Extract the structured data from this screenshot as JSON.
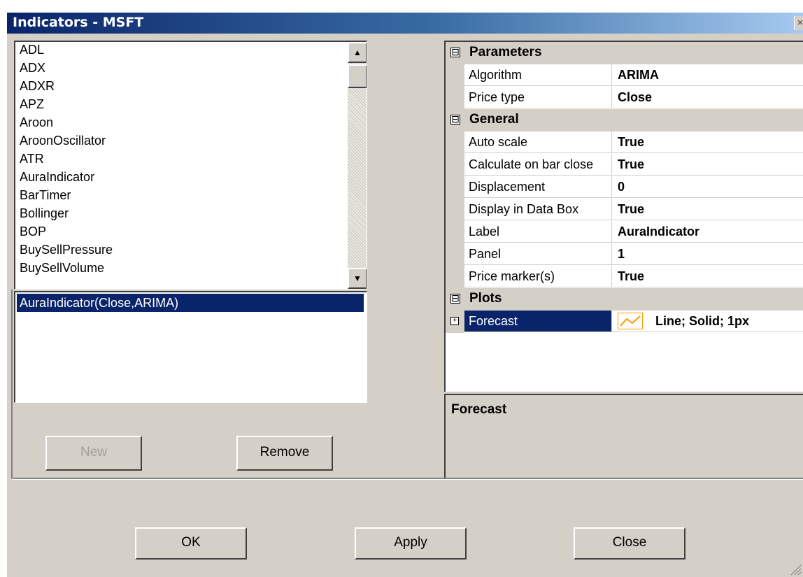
{
  "window": {
    "title": "Indicators - MSFT",
    "close_glyph": "×"
  },
  "indicator_list": {
    "items": [
      "ADL",
      "ADX",
      "ADXR",
      "APZ",
      "Aroon",
      "AroonOscillator",
      "ATR",
      "AuraIndicator",
      "BarTimer",
      "Bollinger",
      "BOP",
      "BuySellPressure",
      "BuySellVolume"
    ],
    "scroll_up_glyph": "▲",
    "scroll_down_glyph": "▼"
  },
  "selected_list": {
    "items": [
      "AuraIndicator(Close,ARIMA)"
    ]
  },
  "left_buttons": {
    "new_label": "New",
    "remove_label": "Remove"
  },
  "property_grid": {
    "expanded_glyph": "⊟",
    "collapsed_glyph": "+",
    "categories": [
      {
        "label": "Parameters",
        "rows": [
          {
            "name": "Algorithm",
            "value": "ARIMA"
          },
          {
            "name": "Price type",
            "value": "Close"
          }
        ]
      },
      {
        "label": "General",
        "rows": [
          {
            "name": "Auto scale",
            "value": "True"
          },
          {
            "name": "Calculate on bar close",
            "value": "True"
          },
          {
            "name": "Displacement",
            "value": "0"
          },
          {
            "name": "Display in Data Box",
            "value": "True"
          },
          {
            "name": "Label",
            "value": "AuraIndicator"
          },
          {
            "name": "Panel",
            "value": "1"
          },
          {
            "name": "Price marker(s)",
            "value": "True"
          }
        ]
      },
      {
        "label": "Plots",
        "rows": [
          {
            "name": "Forecast",
            "value": "Line; Solid; 1px",
            "icon": "line-plot-icon",
            "icon_color": "#ff9900"
          }
        ]
      }
    ]
  },
  "description": {
    "title": "Forecast"
  },
  "dialog_buttons": {
    "ok_label": "OK",
    "apply_label": "Apply",
    "close_label": "Close"
  },
  "colors": {
    "title_bar": "#0a246a",
    "selection": "#0a246a",
    "face": "#d4d0c8"
  }
}
